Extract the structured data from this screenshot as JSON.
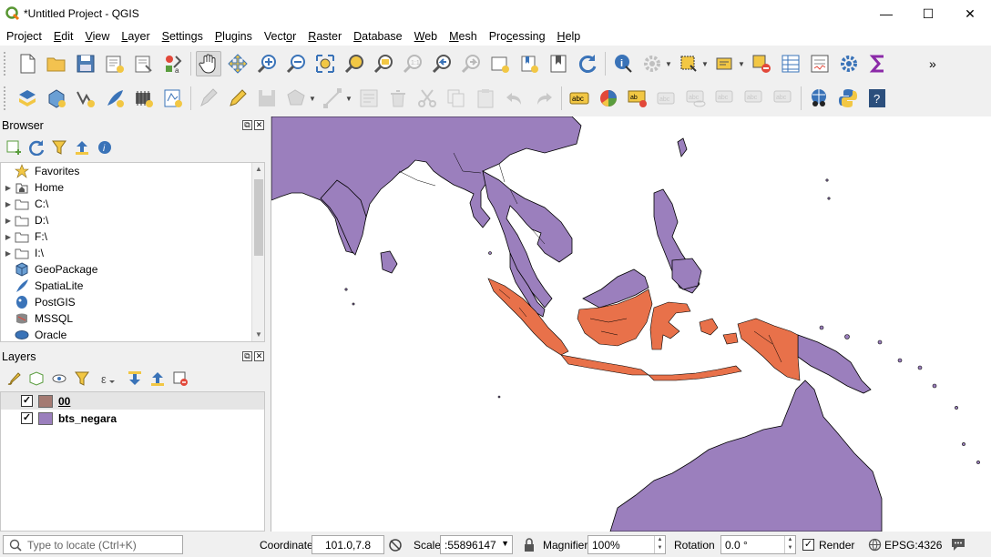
{
  "window": {
    "title": "*Untitled Project - QGIS",
    "controls": [
      "minimize",
      "maximize",
      "close"
    ]
  },
  "menu": [
    {
      "label": "Project",
      "key": "j"
    },
    {
      "label": "Edit",
      "key": "E"
    },
    {
      "label": "View",
      "key": "V"
    },
    {
      "label": "Layer",
      "key": "L"
    },
    {
      "label": "Settings",
      "key": "S"
    },
    {
      "label": "Plugins",
      "key": "P"
    },
    {
      "label": "Vector",
      "key": "o"
    },
    {
      "label": "Raster",
      "key": "R"
    },
    {
      "label": "Database",
      "key": "D"
    },
    {
      "label": "Web",
      "key": "W"
    },
    {
      "label": "Mesh",
      "key": "M"
    },
    {
      "label": "Processing",
      "key": "c"
    },
    {
      "label": "Help",
      "key": "H"
    }
  ],
  "browser": {
    "title": "Browser",
    "items": [
      {
        "label": "Favorites",
        "icon": "star-icon",
        "expandable": false
      },
      {
        "label": "Home",
        "icon": "home-folder-icon",
        "expandable": true
      },
      {
        "label": "C:\\",
        "icon": "folder-icon",
        "expandable": true
      },
      {
        "label": "D:\\",
        "icon": "folder-icon",
        "expandable": true
      },
      {
        "label": "F:\\",
        "icon": "folder-icon",
        "expandable": true
      },
      {
        "label": "I:\\",
        "icon": "folder-icon",
        "expandable": true
      },
      {
        "label": "GeoPackage",
        "icon": "geopackage-icon",
        "expandable": false
      },
      {
        "label": "SpatiaLite",
        "icon": "spatialite-icon",
        "expandable": false
      },
      {
        "label": "PostGIS",
        "icon": "postgis-icon",
        "expandable": false
      },
      {
        "label": "MSSQL",
        "icon": "mssql-icon",
        "expandable": false
      },
      {
        "label": "Oracle",
        "icon": "oracle-icon",
        "expandable": false
      }
    ]
  },
  "layers": {
    "title": "Layers",
    "items": [
      {
        "label": "00",
        "checked": true,
        "color": "#a47a72",
        "selected": true
      },
      {
        "label": "bts_negara",
        "checked": true,
        "color": "#9b7fbd",
        "selected": false
      }
    ]
  },
  "map": {
    "land_color": "#9b7fbd",
    "highlight_color": "#e8714a"
  },
  "status": {
    "locate_placeholder": "Type to locate (Ctrl+K)",
    "coordinate_label": "Coordinate",
    "coordinate_value": "101.0,7.8",
    "scale_label": "Scale",
    "scale_value": ":55896147",
    "magnifier_label": "Magnifier",
    "magnifier_value": "100%",
    "rotation_label": "Rotation",
    "rotation_value": "0.0 °",
    "render_label": "Render",
    "epsg": "EPSG:4326"
  }
}
